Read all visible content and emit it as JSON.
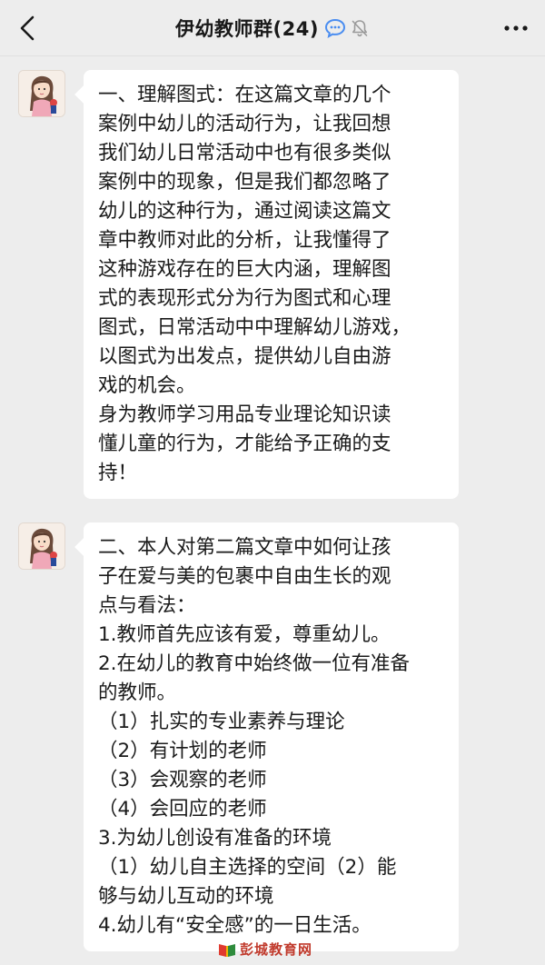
{
  "header": {
    "title": "伊幼教师群(24)",
    "icons": [
      "chevron-left-icon",
      "chat-bubble-icon",
      "mute-bell-icon",
      "more-dots-icon"
    ]
  },
  "messages": [
    {
      "lines": [
        "一、理解图式：在这篇文章的几个",
        "案例中幼儿的活动行为，让我回想",
        "我们幼儿日常活动中也有很多类似",
        "案例中的现象，但是我们都忽略了",
        "幼儿的这种行为，通过阅读这篇文",
        "章中教师对此的分析，让我懂得了",
        "这种游戏存在的巨大内涵，理解图",
        "式的表现形式分为行为图式和心理",
        "图式，日常活动中中理解幼儿游戏，",
        "以图式为出发点，提供幼儿自由游",
        "戏的机会。",
        "身为教师学习用品专业理论知识读",
        "懂儿童的行为，才能给予正确的支",
        "持！"
      ]
    },
    {
      "lines": [
        "二、本人对第二篇文章中如何让孩",
        "子在爱与美的包裹中自由生长的观",
        "点与看法：",
        "1.教师首先应该有爱，尊重幼儿。",
        "2.在幼儿的教育中始终做一位有准备",
        "的教师。",
        "（1）扎实的专业素养与理论",
        "（2）有计划的老师",
        "（3）会观察的老师",
        "（4）会回应的老师",
        "3.为幼儿创设有准备的环境",
        "（1）幼儿自主选择的空间（2）能",
        "够与幼儿互动的环境",
        "4.幼儿有“安全感”的一日生活。"
      ]
    }
  ],
  "watermark": {
    "text": "彭城教育网",
    "icon": "book-logo-icon"
  },
  "colors": {
    "background": "#ededed",
    "bubble": "#ffffff",
    "title": "#191919",
    "text": "#1a1a1a",
    "chat_icon_blue": "#4a8df0",
    "watermark_red": "#c0392b"
  }
}
